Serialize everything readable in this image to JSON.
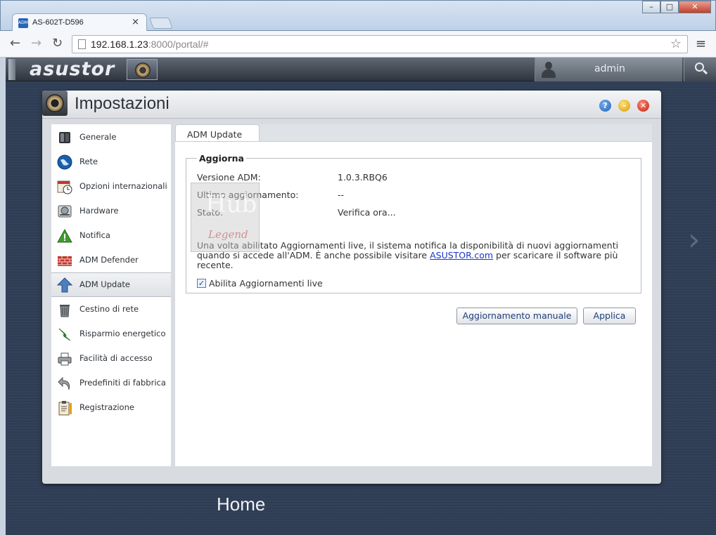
{
  "browser": {
    "tab_title": "AS-602T-D596",
    "tab_favicon": "ADM",
    "url_host": "192.168.1.23",
    "url_rest": ":8000/portal/#",
    "window_buttons": [
      "–",
      "□",
      "✕"
    ]
  },
  "appbar": {
    "logo": "asustor",
    "username": "admin"
  },
  "desktop": {
    "home_label": "Home"
  },
  "window": {
    "title": "Impostazioni",
    "help_btn": "?",
    "min_btn": "–",
    "close_btn": "✕"
  },
  "sidebar": {
    "items": [
      {
        "label": "Generale",
        "icon": "server-icon"
      },
      {
        "label": "Rete",
        "icon": "globe-icon"
      },
      {
        "label": "Opzioni internazionali",
        "icon": "calendar-clock-icon"
      },
      {
        "label": "Hardware",
        "icon": "harddisk-icon"
      },
      {
        "label": "Notifica",
        "icon": "warning-icon"
      },
      {
        "label": "ADM Defender",
        "icon": "firewall-icon"
      },
      {
        "label": "ADM Update",
        "icon": "upload-arrow-icon"
      },
      {
        "label": "Cestino di rete",
        "icon": "trash-icon"
      },
      {
        "label": "Risparmio energetico",
        "icon": "lightning-icon"
      },
      {
        "label": "Facilità di accesso",
        "icon": "printer-icon"
      },
      {
        "label": "Predefiniti di fabbrica",
        "icon": "undo-arrow-icon"
      },
      {
        "label": "Registrazione",
        "icon": "clipboard-icon"
      }
    ],
    "active_index": 6
  },
  "content": {
    "tab_label": "ADM Update",
    "group_title": "Aggiorna",
    "rows": [
      {
        "key": "Versione ADM:",
        "value": "1.0.3.RBQ6"
      },
      {
        "key": "Ultimo aggiornamento:",
        "value": "--"
      },
      {
        "key": "Stato:",
        "value": "Verifica ora..."
      }
    ],
    "description_before": "Una volta abilitato Aggiornamenti live, il sistema notifica la disponibilità di nuovi aggiornamenti quando si accede all'ADM. È anche possibile visitare ",
    "description_link": "ASUSTOR.com",
    "description_after": " per scaricare il software più recente.",
    "checkbox_label": "Abilita Aggiornamenti live",
    "checkbox_checked": true,
    "manual_button": "Aggiornamento manuale",
    "apply_button": "Applica"
  },
  "watermark": {
    "line1": "Hub",
    "line2": "Legend"
  }
}
